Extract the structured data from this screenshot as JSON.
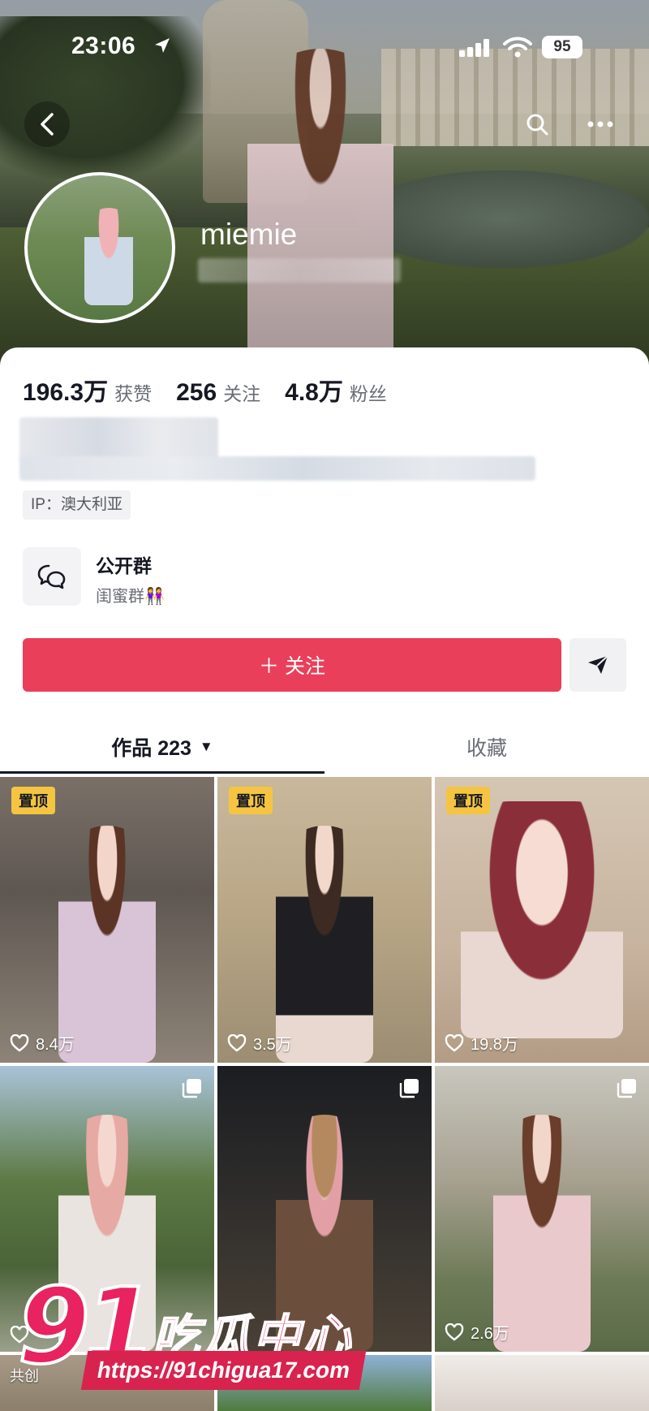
{
  "status_bar": {
    "time": "23:06",
    "battery": "95"
  },
  "profile": {
    "username": "miemie",
    "stats": [
      {
        "value": "196.3万",
        "label": "获赞"
      },
      {
        "value": "256",
        "label": "关注"
      },
      {
        "value": "4.8万",
        "label": "粉丝"
      }
    ],
    "ip": "IP：澳大利亚"
  },
  "group": {
    "title": "公开群",
    "subtitle": "闺蜜群👭"
  },
  "actions": {
    "follow_label": "＋ 关注"
  },
  "tabs": {
    "works_label": "作品 223",
    "favorites_label": "收藏"
  },
  "videos": [
    {
      "pinned": "置顶",
      "likes": "8.4万"
    },
    {
      "pinned": "置顶",
      "likes": "3.5万"
    },
    {
      "pinned": "置顶",
      "likes": "19.8万"
    },
    {
      "multi": true,
      "likes": ""
    },
    {
      "multi": true,
      "likes": ""
    },
    {
      "multi": true,
      "likes": "2.6万"
    },
    {
      "co_label": "共创"
    }
  ],
  "watermark": {
    "number": "91",
    "text": "吃瓜中心",
    "url": "https://91chigua17.com"
  },
  "colors": {
    "accent": "#ea3f5a",
    "pin_badge": "#f5c542",
    "watermark": "#e8235f"
  }
}
